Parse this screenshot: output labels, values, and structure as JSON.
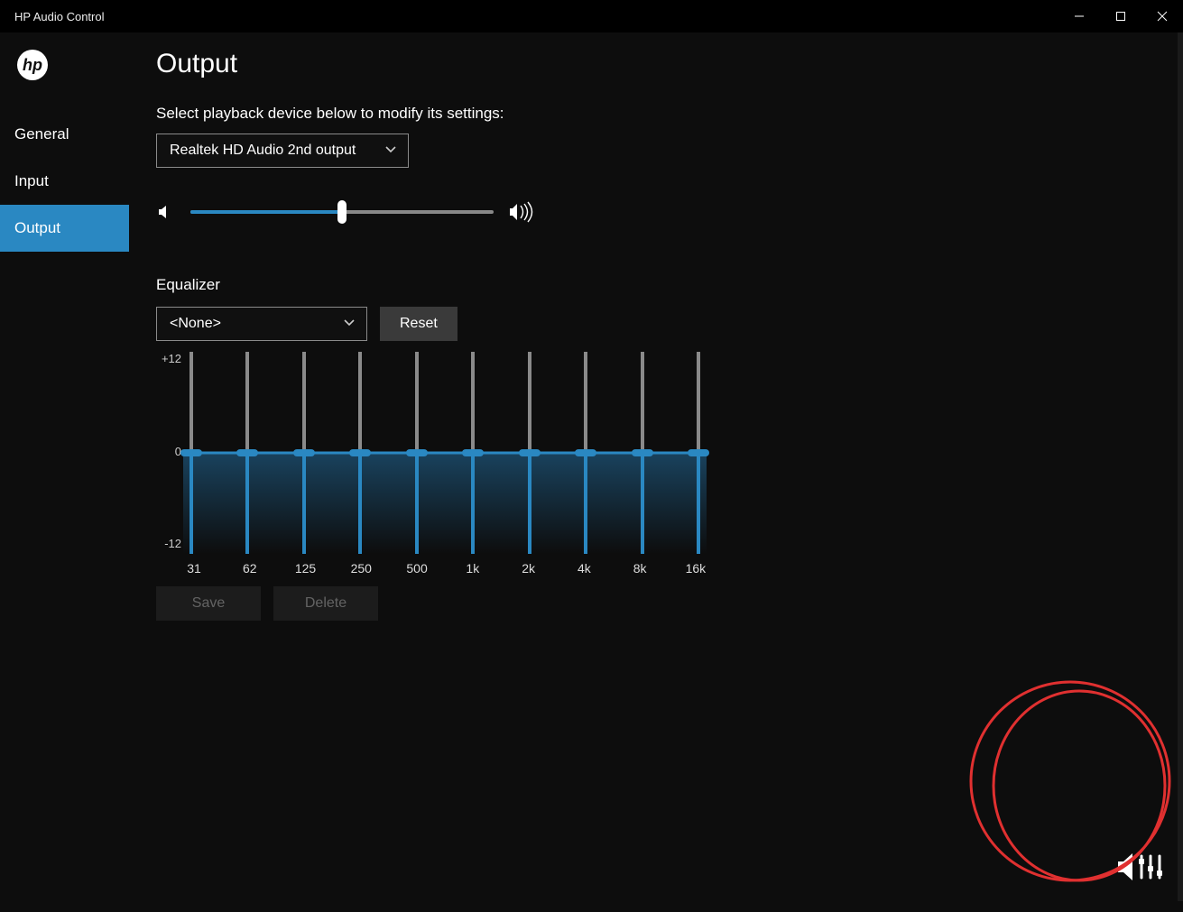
{
  "window": {
    "title": "HP Audio Control"
  },
  "sidebar": {
    "items": [
      "General",
      "Input",
      "Output"
    ],
    "active_index": 2
  },
  "page": {
    "title": "Output",
    "device_prompt": "Select playback device below to modify its settings:",
    "device_selected": "Realtek HD Audio 2nd output",
    "volume_percent": 50,
    "equalizer_label": "Equalizer",
    "preset_selected": "<None>",
    "reset_label": "Reset",
    "save_label": "Save",
    "delete_label": "Delete",
    "eq_y_top": "+12",
    "eq_y_mid": "0",
    "eq_y_bot": "-12",
    "eq_bands": [
      "31",
      "62",
      "125",
      "250",
      "500",
      "1k",
      "2k",
      "4k",
      "8k",
      "16k"
    ],
    "eq_values": [
      0,
      0,
      0,
      0,
      0,
      0,
      0,
      0,
      0,
      0
    ]
  }
}
